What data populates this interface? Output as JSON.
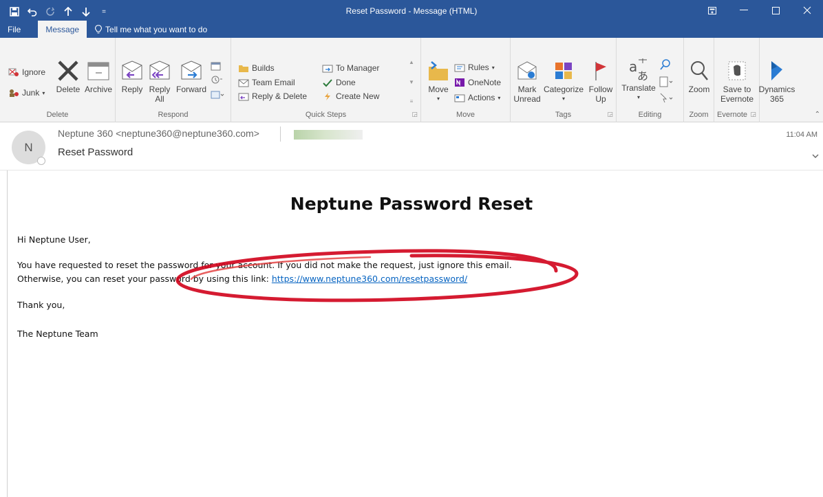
{
  "window": {
    "title": "Reset Password  -  Message (HTML)",
    "qat_more": "="
  },
  "tabs": {
    "file": "File",
    "message": "Message",
    "tell_me": "Tell me what you want to do"
  },
  "ribbon": {
    "delete_group": {
      "label": "Delete",
      "ignore": "Ignore",
      "junk": "Junk",
      "delete": "Delete",
      "archive": "Archive"
    },
    "respond_group": {
      "label": "Respond",
      "reply": "Reply",
      "reply_all_1": "Reply",
      "reply_all_2": "All",
      "forward": "Forward"
    },
    "quick_steps": {
      "label": "Quick Steps",
      "builds": "Builds",
      "team_email": "Team Email",
      "reply_delete": "Reply & Delete",
      "to_manager": "To Manager",
      "done": "Done",
      "create_new": "Create New"
    },
    "move_group": {
      "label": "Move",
      "move": "Move",
      "rules": "Rules",
      "onenote": "OneNote",
      "actions": "Actions"
    },
    "tags_group": {
      "label": "Tags",
      "mark_unread_1": "Mark",
      "mark_unread_2": "Unread",
      "categorize": "Categorize",
      "follow_up_1": "Follow",
      "follow_up_2": "Up"
    },
    "editing_group": {
      "label": "Editing",
      "translate": "Translate"
    },
    "zoom_group": {
      "label": "Zoom",
      "zoom": "Zoom"
    },
    "evernote_group": {
      "label": "Evernote",
      "save_1": "Save to",
      "save_2": "Evernote"
    },
    "dynamics": {
      "line1": "Dynamics",
      "line2": "365"
    }
  },
  "header": {
    "avatar_initial": "N",
    "from": "Neptune 360 <neptune360@neptune360.com>",
    "subject": "Reset Password",
    "time": "11:04 AM"
  },
  "email": {
    "title": "Neptune Password Reset",
    "greeting": "Hi Neptune User,",
    "line1": "You have requested to reset the password for your account. If you did not make the request, just ignore this email.",
    "line2_prefix": "Otherwise, you can reset your password by using this link: ",
    "link": "https://www.neptune360.com/resetpassword/",
    "thanks": "Thank you,",
    "signature": "The Neptune Team"
  },
  "colors": {
    "titlebar": "#2b579a",
    "ribbon_bg": "#f3f3f3",
    "link": "#0563c1",
    "annotation": "#d0021b"
  }
}
